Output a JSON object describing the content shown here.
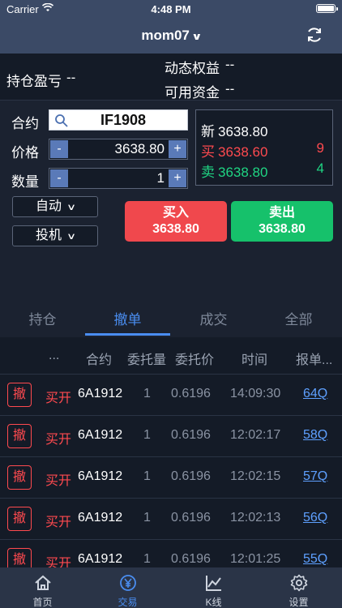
{
  "status_bar": {
    "carrier": "Carrier",
    "time": "4:48 PM"
  },
  "nav": {
    "title": "mom07"
  },
  "account": {
    "pnl_label": "持仓盈亏",
    "pnl_value": "--",
    "equity_label": "动态权益",
    "equity_value": "--",
    "available_label": "可用资金",
    "available_value": "--"
  },
  "order_form": {
    "contract_label": "合约",
    "contract_value": "IF1908",
    "price_label": "价格",
    "price_value": "3638.80",
    "qty_label": "数量",
    "qty_value": "1",
    "minus": "-",
    "plus": "+",
    "order_type": "自动",
    "hedge_type": "投机"
  },
  "quote": {
    "last_label": "新",
    "last_value": "3638.80",
    "bid_label": "买",
    "bid_value": "3638.60",
    "bid_qty": "9",
    "ask_label": "卖",
    "ask_value": "3638.80",
    "ask_qty": "4"
  },
  "actions": {
    "buy_label": "买入",
    "buy_price": "3638.80",
    "sell_label": "卖出",
    "sell_price": "3638.80"
  },
  "tabs": [
    "持仓",
    "撤单",
    "成交",
    "全部"
  ],
  "table": {
    "headers": [
      "...",
      "合约",
      "委托量",
      "委托价",
      "时间",
      "报单..."
    ],
    "cancel_label": "撤",
    "rows": [
      {
        "dir": "买开",
        "code": "6A1912",
        "qty": "1",
        "price": "0.6196",
        "time": "14:09:30",
        "ref": "64Q"
      },
      {
        "dir": "买开",
        "code": "6A1912",
        "qty": "1",
        "price": "0.6196",
        "time": "12:02:17",
        "ref": "58Q"
      },
      {
        "dir": "买开",
        "code": "6A1912",
        "qty": "1",
        "price": "0.6196",
        "time": "12:02:15",
        "ref": "57Q"
      },
      {
        "dir": "买开",
        "code": "6A1912",
        "qty": "1",
        "price": "0.6196",
        "time": "12:02:13",
        "ref": "56Q"
      },
      {
        "dir": "买开",
        "code": "6A1912",
        "qty": "1",
        "price": "0.6196",
        "time": "12:01:25",
        "ref": "55Q"
      }
    ]
  },
  "tabbar": [
    {
      "label": "首页",
      "icon": "home-icon"
    },
    {
      "label": "交易",
      "icon": "yen-icon"
    },
    {
      "label": "K线",
      "icon": "chart-icon"
    },
    {
      "label": "设置",
      "icon": "gear-icon"
    }
  ],
  "colors": {
    "up": "#ff4a4f",
    "down": "#1fd583",
    "accent": "#4a8df0",
    "nav": "#3b4a66"
  }
}
